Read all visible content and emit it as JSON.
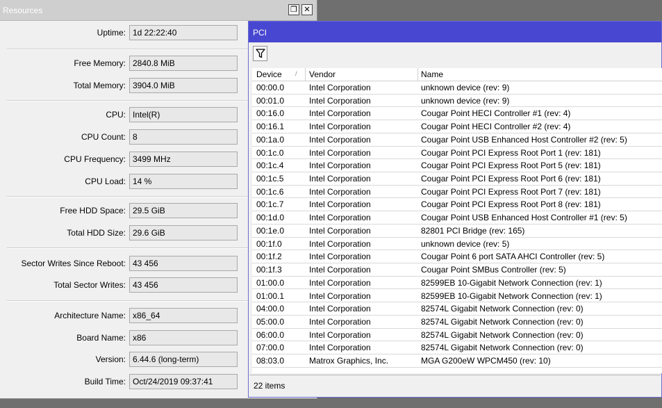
{
  "resources": {
    "title": "Resources",
    "restore_glyph": "❐",
    "close_glyph": "✕",
    "fields": [
      {
        "label": "Uptime:",
        "value": "1d 22:22:40"
      },
      {
        "label": "Free Memory:",
        "value": "2840.8 MiB"
      },
      {
        "label": "Total Memory:",
        "value": "3904.0 MiB"
      },
      {
        "label": "CPU:",
        "value": "Intel(R)"
      },
      {
        "label": "CPU Count:",
        "value": "8"
      },
      {
        "label": "CPU Frequency:",
        "value": "3499 MHz"
      },
      {
        "label": "CPU Load:",
        "value": "14 %"
      },
      {
        "label": "Free HDD Space:",
        "value": "29.5 GiB"
      },
      {
        "label": "Total HDD Size:",
        "value": "29.6 GiB"
      },
      {
        "label": "Sector Writes Since Reboot:",
        "value": "43 456"
      },
      {
        "label": "Total Sector Writes:",
        "value": "43 456"
      },
      {
        "label": "Architecture Name:",
        "value": "x86_64"
      },
      {
        "label": "Board Name:",
        "value": "x86"
      },
      {
        "label": "Version:",
        "value": "6.44.6 (long-term)"
      },
      {
        "label": "Build Time:",
        "value": "Oct/24/2019 09:37:41"
      }
    ]
  },
  "pci": {
    "title": "PCI",
    "filter_icon": "funnel-icon",
    "columns": [
      "Device",
      "Vendor",
      "Name"
    ],
    "sort_glyph": "/",
    "rows": [
      [
        "00:00.0",
        "Intel Corporation",
        "unknown device (rev: 9)"
      ],
      [
        "00:01.0",
        "Intel Corporation",
        "unknown device (rev: 9)"
      ],
      [
        "00:16.0",
        "Intel Corporation",
        "Cougar Point HECI Controller #1 (rev: 4)"
      ],
      [
        "00:16.1",
        "Intel Corporation",
        "Cougar Point HECI Controller #2 (rev: 4)"
      ],
      [
        "00:1a.0",
        "Intel Corporation",
        "Cougar Point USB Enhanced Host Controller #2 (rev: 5)"
      ],
      [
        "00:1c.0",
        "Intel Corporation",
        "Cougar Point PCI Express Root Port 1 (rev: 181)"
      ],
      [
        "00:1c.4",
        "Intel Corporation",
        "Cougar Point PCI Express Root Port 5 (rev: 181)"
      ],
      [
        "00:1c.5",
        "Intel Corporation",
        "Cougar Point PCI Express Root Port 6 (rev: 181)"
      ],
      [
        "00:1c.6",
        "Intel Corporation",
        "Cougar Point PCI Express Root Port 7 (rev: 181)"
      ],
      [
        "00:1c.7",
        "Intel Corporation",
        "Cougar Point PCI Express Root Port 8 (rev: 181)"
      ],
      [
        "00:1d.0",
        "Intel Corporation",
        "Cougar Point USB Enhanced Host Controller #1 (rev: 5)"
      ],
      [
        "00:1e.0",
        "Intel Corporation",
        "82801 PCI Bridge (rev: 165)"
      ],
      [
        "00:1f.0",
        "Intel Corporation",
        "unknown device (rev: 5)"
      ],
      [
        "00:1f.2",
        "Intel Corporation",
        "Cougar Point 6 port SATA AHCI Controller (rev: 5)"
      ],
      [
        "00:1f.3",
        "Intel Corporation",
        "Cougar Point SMBus Controller (rev: 5)"
      ],
      [
        "01:00.0",
        "Intel Corporation",
        "82599EB 10-Gigabit Network Connection (rev: 1)"
      ],
      [
        "01:00.1",
        "Intel Corporation",
        "82599EB 10-Gigabit Network Connection (rev: 1)"
      ],
      [
        "04:00.0",
        "Intel Corporation",
        "82574L Gigabit Network Connection (rev: 0)"
      ],
      [
        "05:00.0",
        "Intel Corporation",
        "82574L Gigabit Network Connection (rev: 0)"
      ],
      [
        "06:00.0",
        "Intel Corporation",
        "82574L Gigabit Network Connection (rev: 0)"
      ],
      [
        "07:00.0",
        "Intel Corporation",
        "82574L Gigabit Network Connection (rev: 0)"
      ],
      [
        "08:03.0",
        "Matrox Graphics, Inc.",
        "MGA G200eW WPCM450 (rev: 10)"
      ]
    ],
    "status": "22 items"
  }
}
